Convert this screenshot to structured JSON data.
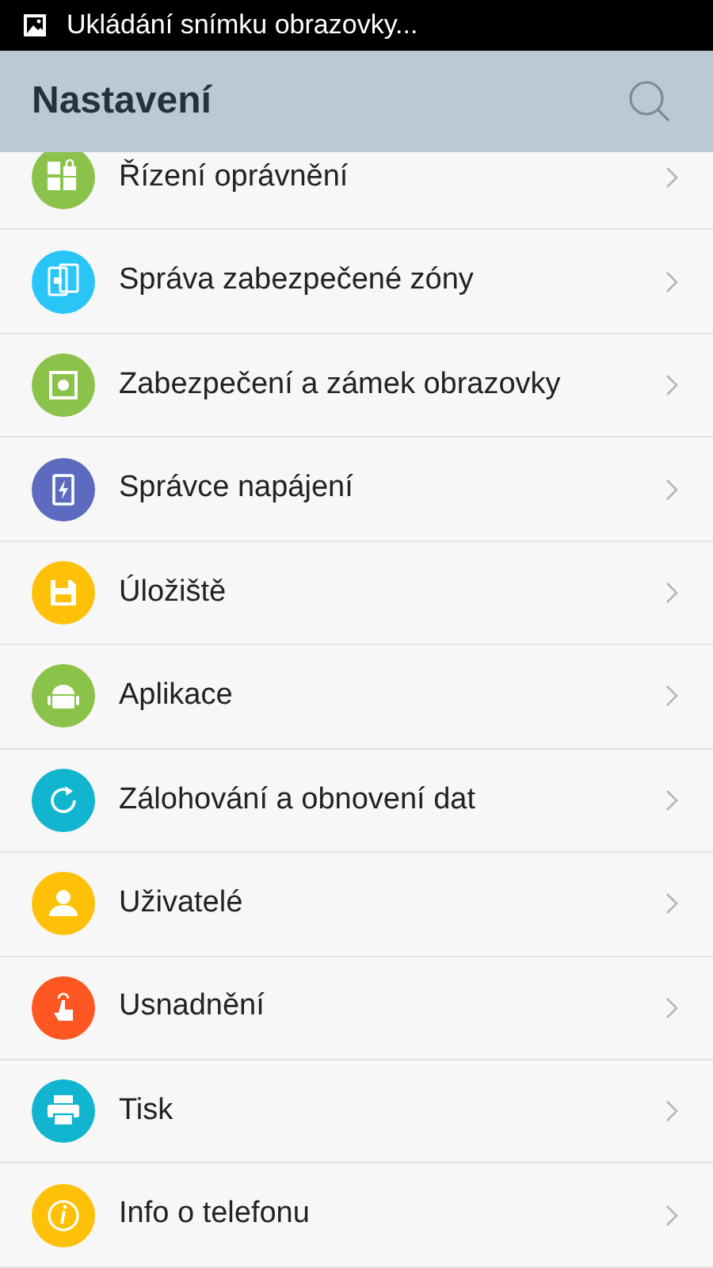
{
  "status_bar": {
    "notification": "Ukládání snímku obrazovky..."
  },
  "header": {
    "title": "Nastavení"
  },
  "items": [
    {
      "label": "Řízení oprávnění",
      "kind": "permissions",
      "color": "#8bc34a"
    },
    {
      "label": "Správa zabezpečené zóny",
      "kind": "secure-zone",
      "color": "#29c5f6"
    },
    {
      "label": "Zabezpečení a zámek obrazovky",
      "kind": "lock",
      "color": "#8bc34a"
    },
    {
      "label": "Správce napájení",
      "kind": "battery",
      "color": "#5c6bc0"
    },
    {
      "label": "Úložiště",
      "kind": "storage",
      "color": "#ffc107"
    },
    {
      "label": "Aplikace",
      "kind": "apps",
      "color": "#8bc34a"
    },
    {
      "label": "Zálohování a obnovení dat",
      "kind": "backup",
      "color": "#12b5d0"
    },
    {
      "label": "Uživatelé",
      "kind": "users",
      "color": "#ffc107"
    },
    {
      "label": "Usnadnění",
      "kind": "accessibility",
      "color": "#ff5722"
    },
    {
      "label": "Tisk",
      "kind": "print",
      "color": "#12b5d0"
    },
    {
      "label": "Info o telefonu",
      "kind": "info",
      "color": "#ffc107"
    }
  ]
}
